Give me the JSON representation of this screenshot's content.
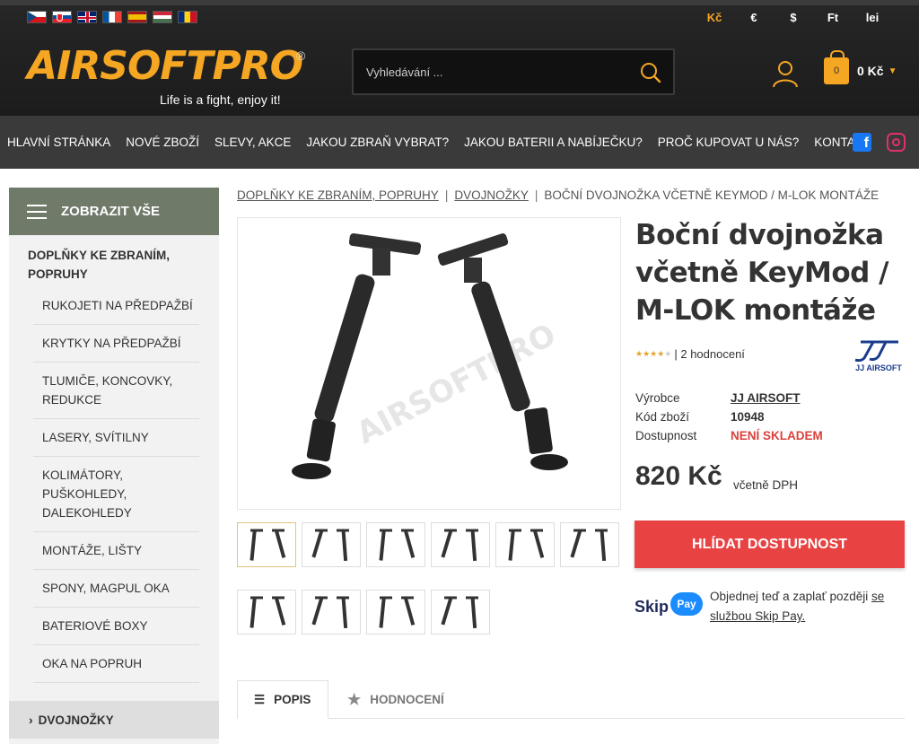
{
  "header": {
    "flags": [
      "cz",
      "sk",
      "gb",
      "fr",
      "es",
      "hu",
      "ro"
    ],
    "currencies": [
      "Kč",
      "€",
      "$",
      "Ft",
      "lei"
    ],
    "active_currency": "Kč",
    "logo": "AIRSOFTPRO",
    "logo_reg": "®",
    "tagline": "Life is a fight, enjoy it!",
    "search_placeholder": "Vyhledávání ...",
    "cart_count": "0",
    "cart_total": "0 Kč"
  },
  "nav": {
    "items": [
      "HLAVNÍ STRÁNKA",
      "NOVÉ ZBOŽÍ",
      "SLEVY, AKCE",
      "JAKOU ZBRAŇ VYBRAT?",
      "JAKOU BATERII A NABÍJEČKU?",
      "PROČ KUPOVAT U NÁS?",
      "KONTAKT"
    ],
    "social": [
      "facebook-icon",
      "instagram-icon"
    ]
  },
  "sidebar": {
    "header": "ZOBRAZIT VŠE",
    "category": "DOPLŇKY KE ZBRANÍM, POPRUHY",
    "items": [
      "RUKOJETI NA PŘEDPAŽBÍ",
      "KRYTKY NA PŘEDPAŽBÍ",
      "TLUMIČE, KONCOVKY, REDUKCE",
      "LASERY, SVÍTILNY",
      "KOLIMÁTORY, PUŠKOHLEDY, DALEKOHLEDY",
      "MONTÁŽE, LIŠTY",
      "SPONY, MAGPUL OKA",
      "BATERIOVÉ BOXY",
      "OKA NA POPRUH"
    ],
    "active": "DVOJNOŽKY"
  },
  "breadcrumb": {
    "items": [
      "DOPLŇKY KE ZBRANÍM, POPRUHY",
      "DVOJNOŽKY",
      "BOČNÍ DVOJNOŽKA VČETNĚ KEYMOD / M-LOK MONTÁŽE"
    ]
  },
  "product": {
    "title": "Boční dvojnožka včetně KeyMod / M-LOK montáže",
    "rating_stars": 4,
    "rating_text": "| 2 hodnocení",
    "brand_logo_text": "JJ AIRSOFT",
    "image_watermark": "AIRSOFTPRO",
    "specs": [
      {
        "label": "Výrobce",
        "value": "JJ AIRSOFT"
      },
      {
        "label": "Kód zboží",
        "value": "10948"
      },
      {
        "label": "Dostupnost",
        "value": "NENÍ SKLADEM"
      }
    ],
    "price": "820 Kč",
    "vat": "včetně DPH",
    "watch_button": "HLÍDAT DOSTUPNOST",
    "skip_word": "Skip",
    "skip_bubble": "Pay",
    "skip_text": "Objednej teď a zaplať později ",
    "skip_link": "se službou Skip Pay.",
    "thumb_count": 10
  },
  "tabs": {
    "description": "POPIS",
    "reviews": "HODNOCENÍ"
  },
  "colors": {
    "accent": "#f5a623",
    "button": "#e84242",
    "sidebar_header": "#6f7a69",
    "out_of_stock": "#d9413c"
  }
}
